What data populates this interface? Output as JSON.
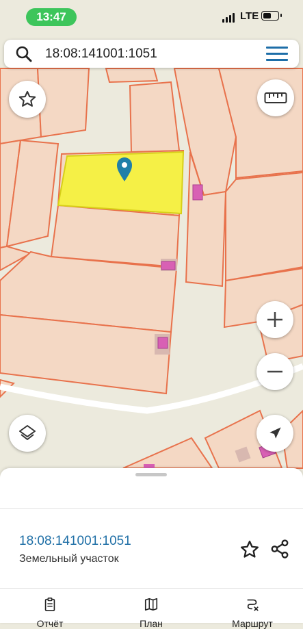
{
  "status_bar": {
    "time": "13:47",
    "network": "LTE"
  },
  "search": {
    "query": "18:08:141001:1051"
  },
  "map": {
    "colors": {
      "background": "#eceadd",
      "parcel_fill": "#f4d8c4",
      "parcel_stroke": "#e8724c",
      "selected_fill": "#f5f046",
      "building_fill": "#d860b4",
      "road": "#ffffff",
      "pin": "#1f7fa8"
    }
  },
  "sheet": {
    "cadastral_number": "18:08:141001:1051",
    "object_type": "Земельный участок"
  },
  "tabs": [
    {
      "label": "Отчёт",
      "icon": "clipboard-icon"
    },
    {
      "label": "План",
      "icon": "map-icon"
    },
    {
      "label": "Маршрут",
      "icon": "route-icon"
    }
  ]
}
